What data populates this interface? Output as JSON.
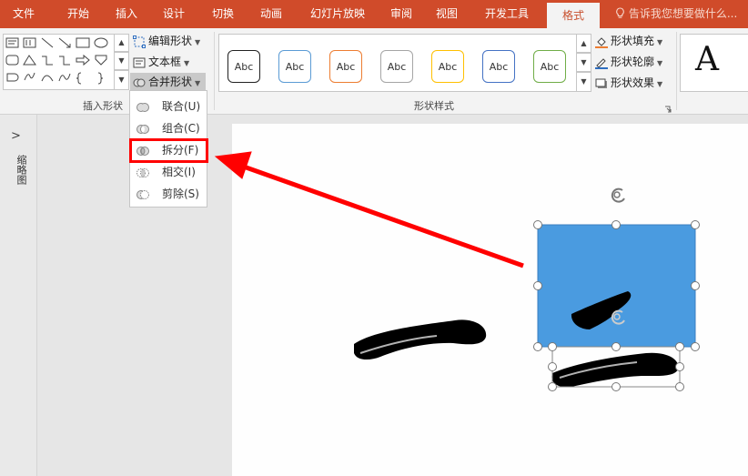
{
  "tabs": [
    {
      "label": "文件",
      "active": false
    },
    {
      "label": "开始",
      "active": false
    },
    {
      "label": "插入",
      "active": false
    },
    {
      "label": "设计",
      "active": false
    },
    {
      "label": "切换",
      "active": false
    },
    {
      "label": "动画",
      "active": false
    },
    {
      "label": "幻灯片放映",
      "active": false
    },
    {
      "label": "审阅",
      "active": false
    },
    {
      "label": "视图",
      "active": false
    },
    {
      "label": "开发工具",
      "active": false
    },
    {
      "label": "格式",
      "active": true
    }
  ],
  "tell_me": "告诉我您想要做什么...",
  "ribbon": {
    "insert_shapes": {
      "group_label": "插入形状",
      "edit_shape": "编辑形状",
      "text_box": "文本框",
      "merge_shapes": "合并形状"
    },
    "shape_styles": {
      "group_label": "形状样式",
      "items": [
        {
          "label": "Abc",
          "border": "#222222"
        },
        {
          "label": "Abc",
          "border": "#5b9bd5"
        },
        {
          "label": "Abc",
          "border": "#ed7d31"
        },
        {
          "label": "Abc",
          "border": "#a5a5a5"
        },
        {
          "label": "Abc",
          "border": "#ffc000"
        },
        {
          "label": "Abc",
          "border": "#4472c4"
        },
        {
          "label": "Abc",
          "border": "#70ad47"
        }
      ],
      "shape_fill": "形状填充",
      "shape_outline": "形状轮廓",
      "shape_effects": "形状效果"
    },
    "wordart_preview": "A"
  },
  "merge_menu": [
    {
      "label": "联合(U)",
      "icon": "union-icon"
    },
    {
      "label": "组合(C)",
      "icon": "combine-icon"
    },
    {
      "label": "拆分(F)",
      "icon": "fragment-icon",
      "highlighted": true
    },
    {
      "label": "相交(I)",
      "icon": "intersect-icon"
    },
    {
      "label": "剪除(S)",
      "icon": "subtract-icon"
    }
  ],
  "left_panel": {
    "expand_glyph": ">",
    "label": "缩略图"
  },
  "colors": {
    "tab_bar": "#d04b2a",
    "selected_shape_fill": "#4a9be0",
    "highlight_box": "#ff0000",
    "arrow": "#ff0000"
  }
}
